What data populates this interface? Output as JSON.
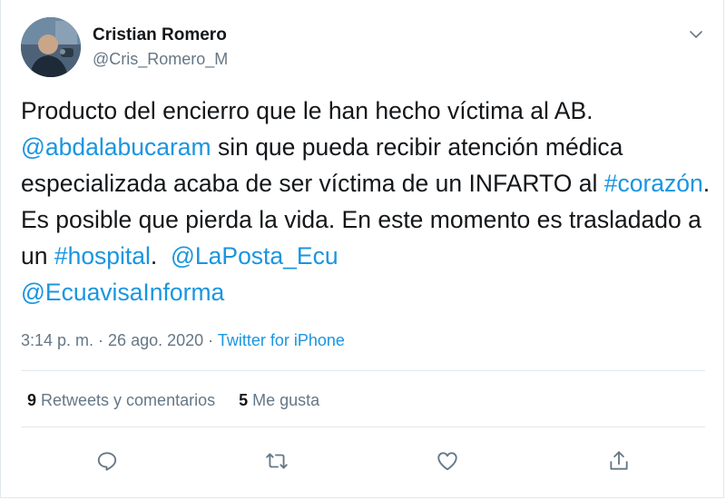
{
  "user": {
    "display_name": "Cristian Romero",
    "handle": "@Cris_Romero_M",
    "avatar_icon": "user-photo-avatar"
  },
  "tweet": {
    "segments": [
      {
        "text": "Producto del encierro que le han hecho víctima al AB. ",
        "link": false
      },
      {
        "text": "@abdalabucaram",
        "link": true
      },
      {
        "text": " sin que pueda recibir atención médica especializada acaba de ser víctima de un INFARTO al ",
        "link": false
      },
      {
        "text": "#corazón",
        "link": true
      },
      {
        "text": ". Es posible que pierda la vida. En este momento es trasladado a un ",
        "link": false
      },
      {
        "text": "#hospital",
        "link": true
      },
      {
        "text": ".  ",
        "link": false
      },
      {
        "text": "@LaPosta_Ecu",
        "link": true
      },
      {
        "text": " ",
        "link": false
      },
      {
        "text": "@EcuavisaInforma",
        "link": true
      }
    ]
  },
  "meta": {
    "time": "3:14 p. m.",
    "separator1": " · ",
    "date": "26 ago. 2020",
    "separator2": " · ",
    "source": "Twitter for iPhone"
  },
  "stats": {
    "retweets_count": "9",
    "retweets_label": "Retweets y comentarios",
    "likes_count": "5",
    "likes_label": "Me gusta"
  },
  "actions": {
    "reply_icon": "reply-icon",
    "retweet_icon": "retweet-icon",
    "like_icon": "heart-icon",
    "share_icon": "share-icon"
  },
  "colors": {
    "link": "#1b95e0",
    "secondary_text": "#657786",
    "primary_text": "#14171a",
    "divider": "#e1e8ed"
  }
}
